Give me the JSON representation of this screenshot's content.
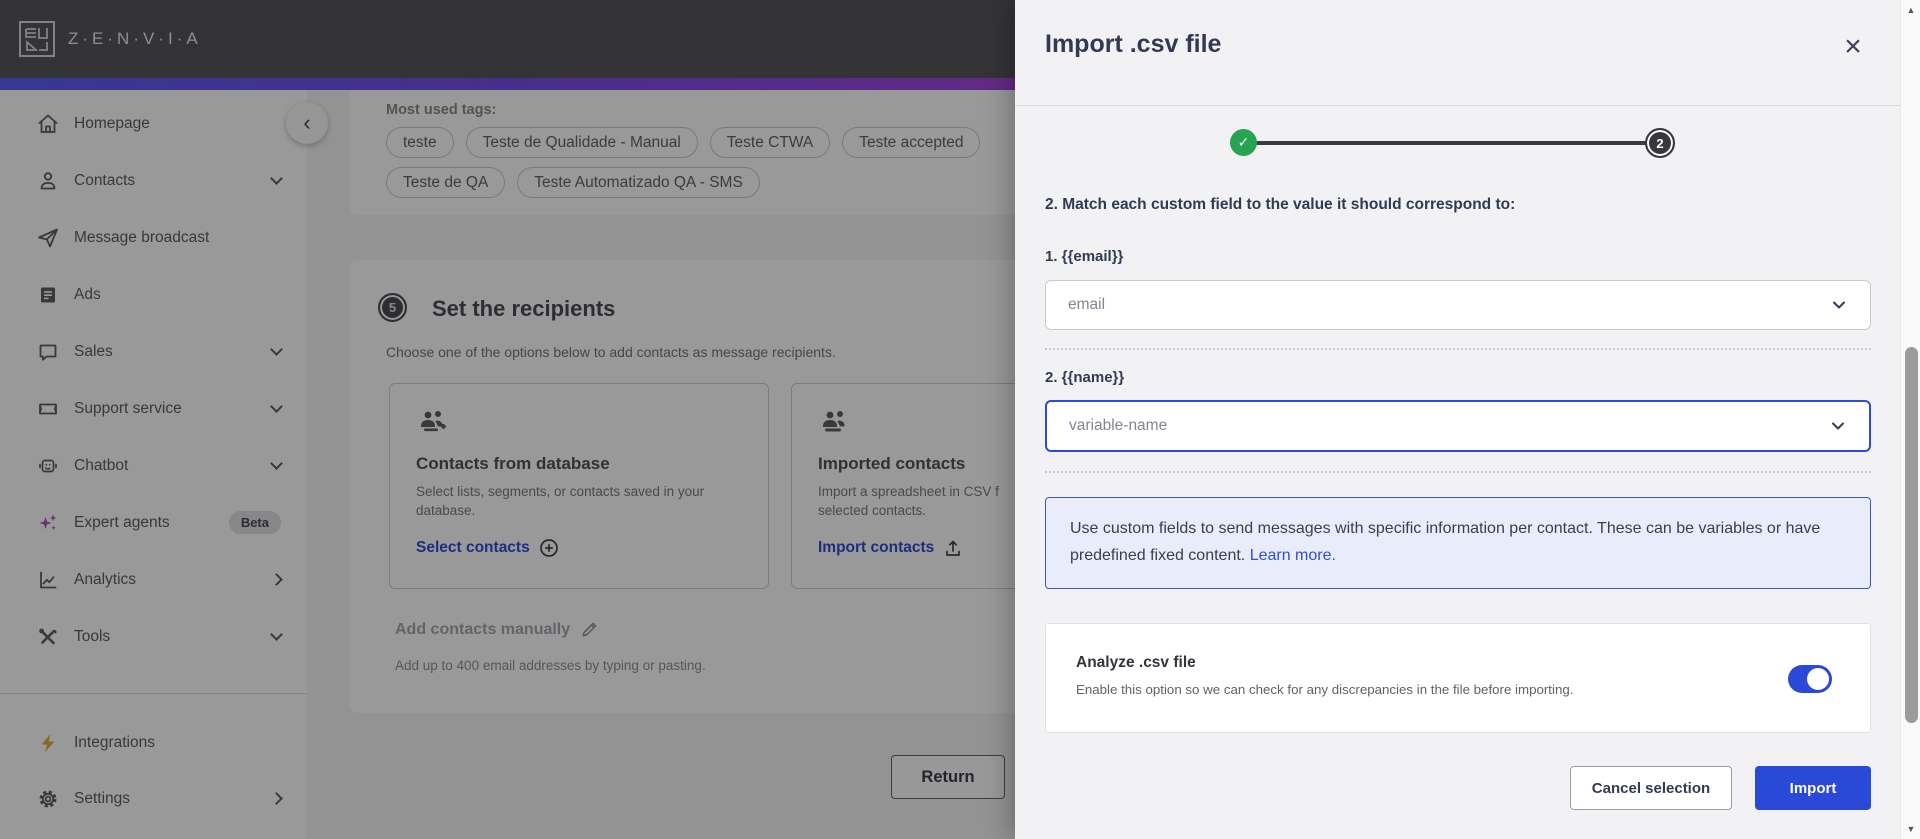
{
  "topbar": {
    "logo_text": "Z·E·N·V·I·A"
  },
  "icons": {
    "collapse_glyph": "‹",
    "close_glyph": "×",
    "check_glyph": "✓"
  },
  "sidebar": {
    "items": [
      {
        "label": "Homepage"
      },
      {
        "label": "Contacts",
        "chevron": "down"
      },
      {
        "label": "Message broadcast"
      },
      {
        "label": "Ads"
      },
      {
        "label": "Sales",
        "chevron": "down"
      },
      {
        "label": "Support service",
        "chevron": "down"
      },
      {
        "label": "Chatbot",
        "chevron": "down"
      },
      {
        "label": "Expert agents",
        "badge": "Beta"
      },
      {
        "label": "Analytics",
        "chevron": "right"
      },
      {
        "label": "Tools",
        "chevron": "down"
      }
    ],
    "footer_items": [
      {
        "label": "Integrations"
      },
      {
        "label": "Settings",
        "chevron": "right"
      }
    ]
  },
  "main": {
    "tags": {
      "label": "Most used tags:",
      "row1": [
        "teste",
        "Teste de Qualidade - Manual",
        "Teste CTWA",
        "Teste accepted"
      ],
      "row2": [
        "Teste de QA",
        "Teste Automatizado QA - SMS"
      ]
    },
    "recipients": {
      "step": "5",
      "title": "Set the recipients",
      "subtitle": "Choose one of the options below to add contacts as message recipients.",
      "cards": [
        {
          "title": "Contacts from database",
          "desc1": "Select lists, segments, or contacts saved in your",
          "desc2": "database.",
          "action": "Select contacts"
        },
        {
          "title": "Imported contacts",
          "desc1": "Import a spreadsheet in CSV f",
          "desc2": "selected contacts.",
          "action": "Import contacts"
        }
      ],
      "manual_label": "Add contacts manually",
      "manual_hint": "Add up to 400 email addresses by typing or pasting.",
      "return_label": "Return"
    }
  },
  "drawer": {
    "title": "Import .csv file",
    "step2": "2",
    "heading": "2. Match each custom field to the value it should correspond to:",
    "fields": [
      {
        "label": "1. {{email}}",
        "value": "email"
      },
      {
        "label": "2. {{name}}",
        "value": "variable-name"
      }
    ],
    "info_text": "Use custom fields to send messages with specific information per contact. These can be variables or have predefined fixed content. ",
    "info_link": "Learn more.",
    "analyze_title": "Analyze .csv file",
    "analyze_desc": "Enable this option so we can check for any discrepancies in the file before importing.",
    "cancel_label": "Cancel selection",
    "import_label": "Import"
  },
  "colors": {
    "accent": "#2e4fd7",
    "success": "#26a44f",
    "toggle_on": "#2b49d8",
    "gradient": [
      "#5b5ff2",
      "#a845e0",
      "#ff37b8"
    ]
  }
}
